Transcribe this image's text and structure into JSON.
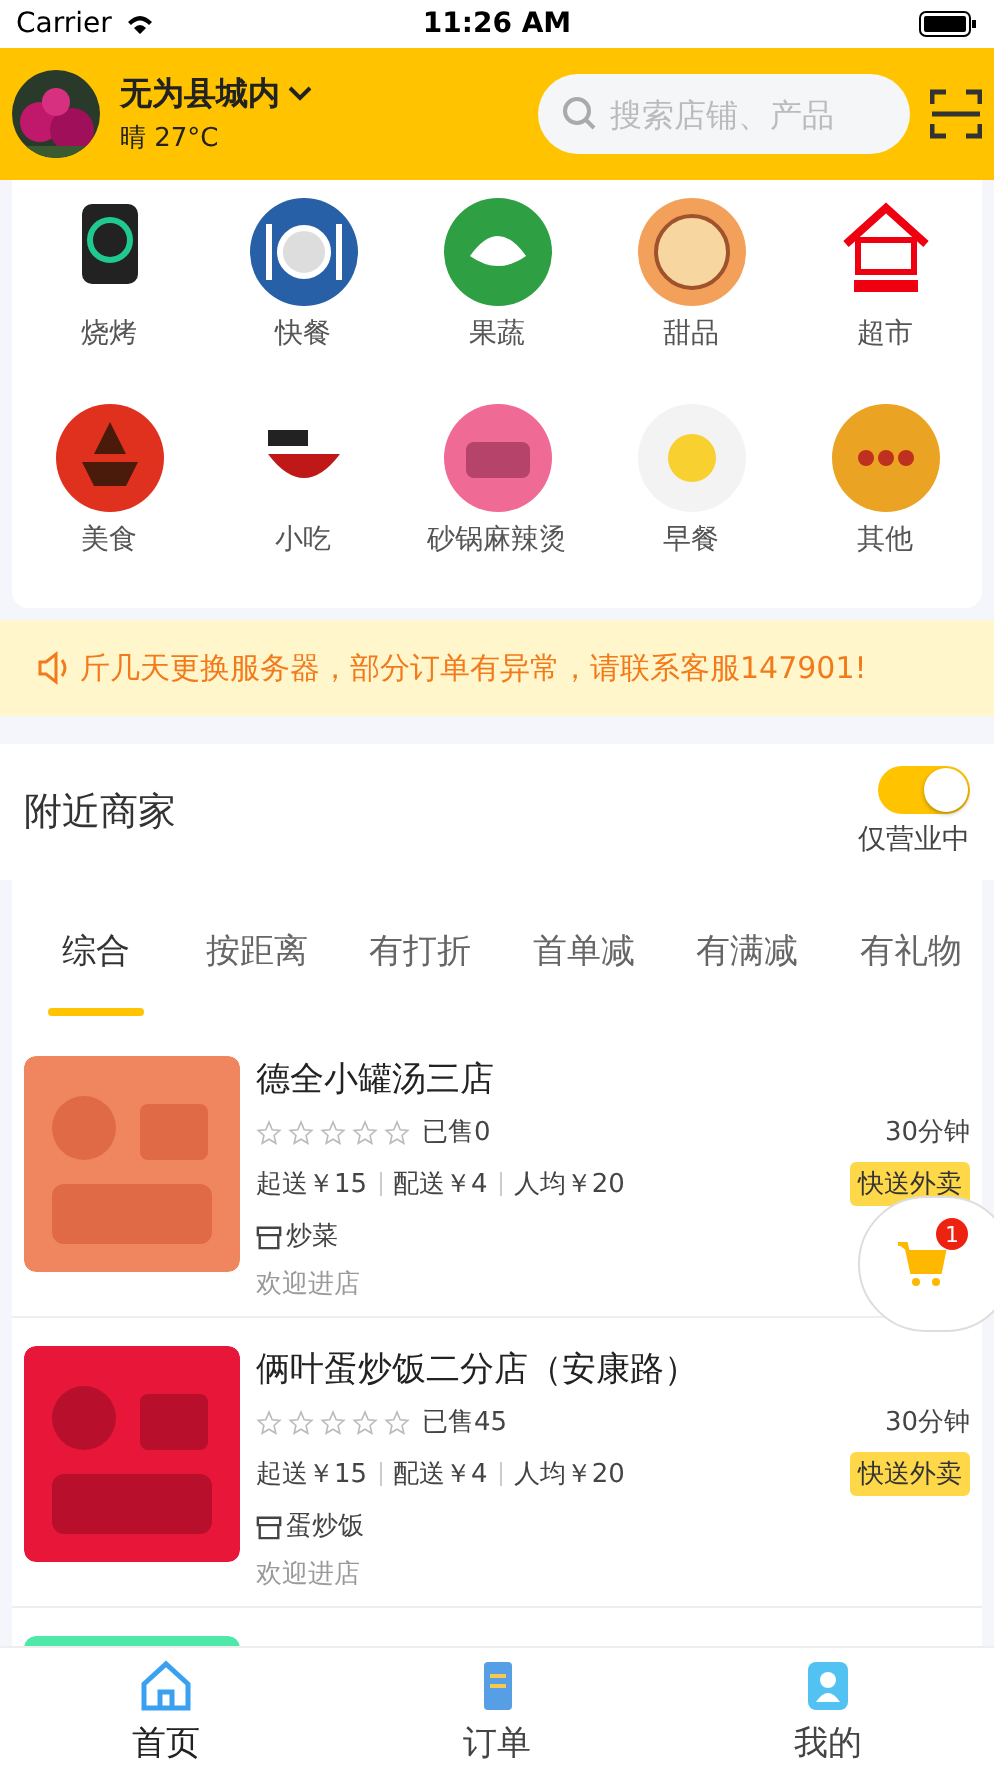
{
  "status_bar": {
    "carrier": "Carrier",
    "time": "11:26 AM"
  },
  "header": {
    "location": "无为县城内",
    "weather": "晴 27°C",
    "search": {
      "placeholder": "搜索店铺、产品"
    }
  },
  "categories": [
    {
      "label": "烧烤",
      "kind": "grill"
    },
    {
      "label": "快餐",
      "kind": "plate"
    },
    {
      "label": "果蔬",
      "kind": "veg"
    },
    {
      "label": "甜品",
      "kind": "cake"
    },
    {
      "label": "超市",
      "kind": "shop"
    },
    {
      "label": "美食",
      "kind": "food"
    },
    {
      "label": "小吃",
      "kind": "snack"
    },
    {
      "label": "砂锅麻辣烫",
      "kind": "pot"
    },
    {
      "label": "早餐",
      "kind": "breakfast"
    },
    {
      "label": "其他",
      "kind": "other"
    }
  ],
  "notice": "斤几天更换服务器，部分订单有异常，请联系客服147901!",
  "nearby": {
    "title": "附近商家",
    "open_only": {
      "label": "仅营业中",
      "on": true
    }
  },
  "filter_tabs": [
    {
      "label": "综合",
      "selected": true
    },
    {
      "label": "按距离",
      "selected": false
    },
    {
      "label": "有打折",
      "selected": false
    },
    {
      "label": "首单减",
      "selected": false
    },
    {
      "label": "有满减",
      "selected": false
    },
    {
      "label": "有礼物",
      "selected": false
    }
  ],
  "stores": [
    {
      "name": "德全小罐汤三店",
      "stars": 0,
      "sold": "已售0",
      "time": "30分钟",
      "min_order": "起送￥15",
      "delivery_fee": "配送￥4",
      "per_person": "人均￥20",
      "tag": "快送外卖",
      "category": "炒菜",
      "slogan": "欢迎进店",
      "image": {
        "kind": "picture"
      }
    },
    {
      "name": "俩叶蛋炒饭二分店（安康路）",
      "stars": 0,
      "sold": "已售45",
      "time": "30分钟",
      "min_order": "起送￥15",
      "delivery_fee": "配送￥4",
      "per_person": "人均￥20",
      "tag": "快送外卖",
      "category": "蛋炒饭",
      "slogan": "欢迎进店",
      "image": {
        "kind": "picture"
      }
    },
    {
      "image": {
        "kind": "picture"
      }
    }
  ],
  "cart": {
    "count": "1"
  },
  "tab_bar": [
    {
      "label": "首页",
      "kind": "home",
      "selected": true
    },
    {
      "label": "订单",
      "kind": "orders",
      "selected": false
    },
    {
      "label": "我的",
      "kind": "me",
      "selected": false
    }
  ]
}
